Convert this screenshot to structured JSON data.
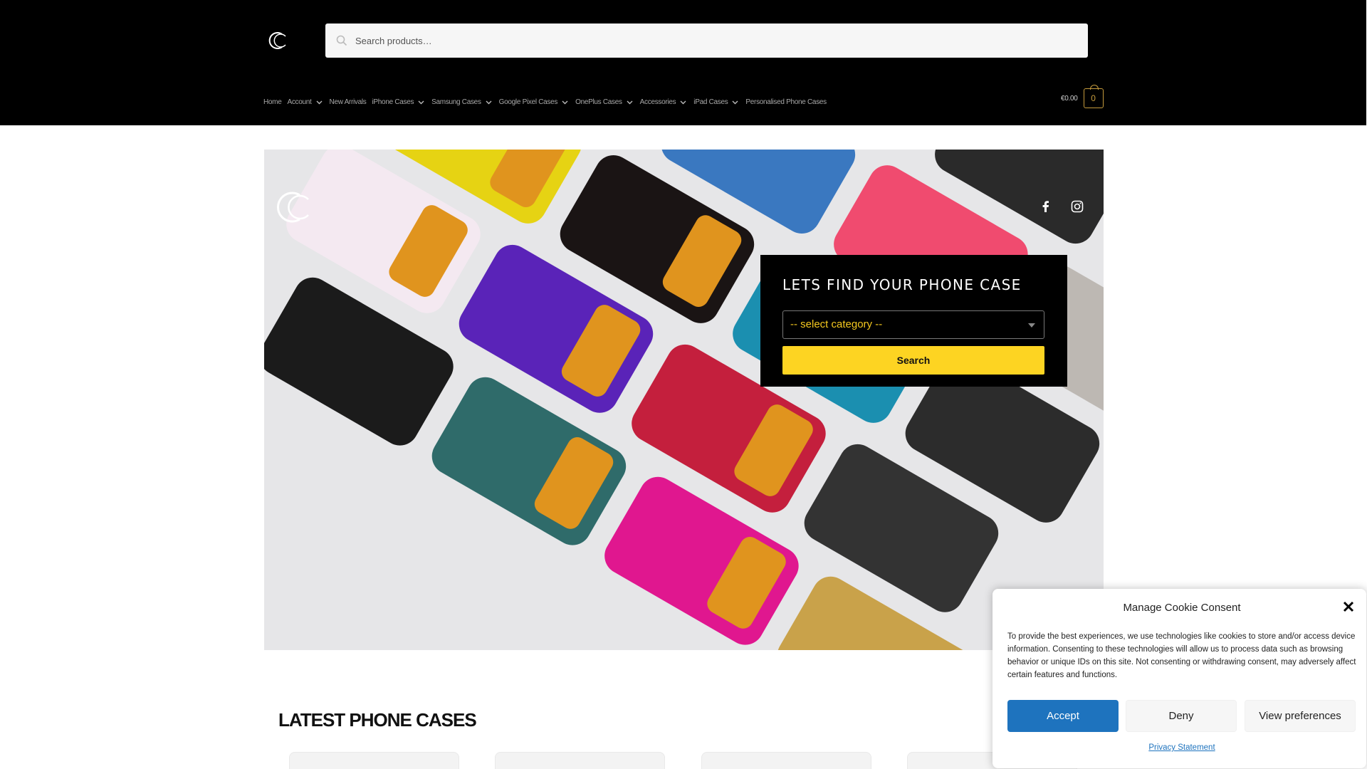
{
  "header": {
    "search_placeholder": "Search products…",
    "nav": [
      {
        "label": "Home",
        "dropdown": false
      },
      {
        "label": "Account",
        "dropdown": true
      },
      {
        "label": "New Arrivals",
        "dropdown": false
      },
      {
        "label": "iPhone Cases",
        "dropdown": true
      },
      {
        "label": "Samsung Cases",
        "dropdown": true
      },
      {
        "label": "Google Pixel Cases",
        "dropdown": true
      },
      {
        "label": "OnePlus Cases",
        "dropdown": true
      },
      {
        "label": "Accessories",
        "dropdown": true
      },
      {
        "label": "iPad Cases",
        "dropdown": true
      },
      {
        "label": "Personalised Phone Cases",
        "dropdown": false
      }
    ],
    "cart_total": "€0.00",
    "cart_count": "0"
  },
  "hero": {
    "finder_title": "LETS FIND YOUR PHONE CASE",
    "select_value": "-- select category --",
    "search_button": "Search",
    "social_icons": [
      "facebook-icon",
      "instagram-icon"
    ]
  },
  "latest": {
    "title": "LATEST PHONE CASES"
  },
  "cookie": {
    "title": "Manage Cookie Consent",
    "text": "To provide the best experiences, we use technologies like cookies to store and/or access device information. Consenting to these technologies will allow us to process data such as browsing behavior or unique IDs on this site. Not consenting or withdrawing consent, may adversely affect certain features and functions.",
    "accept": "Accept",
    "deny": "Deny",
    "preferences": "View preferences",
    "privacy": "Privacy Statement"
  },
  "colors": {
    "header_bg": "#000000",
    "accent_yellow": "#fdd422",
    "cart_gold": "#c59b3d",
    "accept_blue": "#1e73be"
  }
}
